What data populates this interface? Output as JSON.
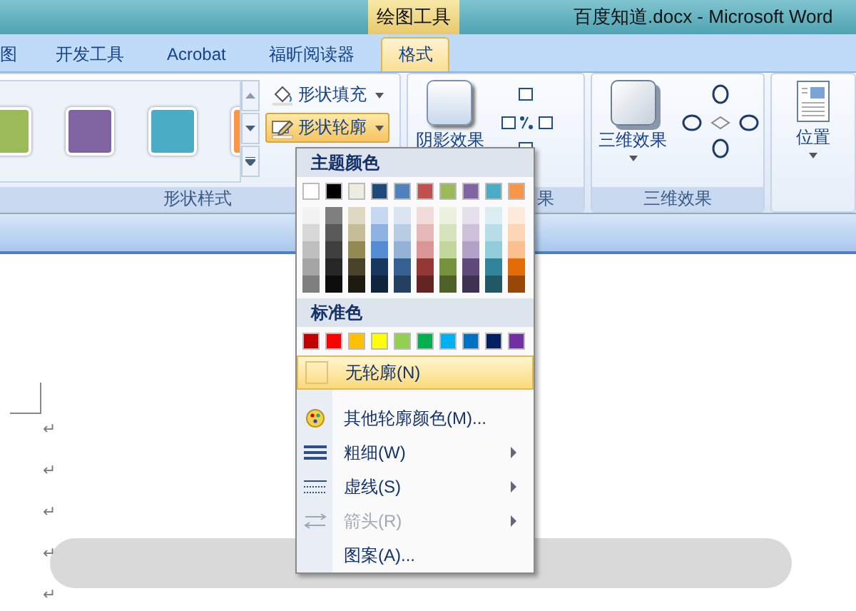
{
  "window": {
    "context_tab": "绘图工具",
    "title": "百度知道.docx - Microsoft Word"
  },
  "tabs": [
    {
      "label": "图",
      "selected": false
    },
    {
      "label": "开发工具",
      "selected": false
    },
    {
      "label": "Acrobat",
      "selected": false
    },
    {
      "label": "福昕阅读器",
      "selected": false
    },
    {
      "label": "格式",
      "selected": true
    }
  ],
  "ribbon": {
    "shape_styles": {
      "swatches": [
        {
          "color": "#9bbb59"
        },
        {
          "color": "#8064a2"
        },
        {
          "color": "#4bacc6"
        },
        {
          "color": "#f79646"
        }
      ],
      "fill_button": {
        "label": "形状填充",
        "pressed": false
      },
      "outline_button": {
        "label": "形状轮廓",
        "pressed": true
      },
      "group_label": "形状样式"
    },
    "shadow": {
      "button_label": "阴影效果",
      "group_label": "果"
    },
    "three_d": {
      "button_label": "三维效果",
      "group_label": "三维效果"
    },
    "arrange": {
      "button_label": "位置"
    }
  },
  "outline_menu": {
    "theme_heading": "主题颜色",
    "theme_colors": [
      {
        "color": "#ffffff",
        "shades": [
          {
            "color": "#f2f2f2"
          },
          {
            "color": "#d8d8d8"
          },
          {
            "color": "#bfbfbf"
          },
          {
            "color": "#a5a5a5"
          },
          {
            "color": "#7f7f7f"
          }
        ]
      },
      {
        "color": "#000000",
        "shades": [
          {
            "color": "#7f7f7f"
          },
          {
            "color": "#595959"
          },
          {
            "color": "#3f3f3f"
          },
          {
            "color": "#262626"
          },
          {
            "color": "#0c0c0c"
          }
        ]
      },
      {
        "color": "#eeece1",
        "shades": [
          {
            "color": "#ddd9c3"
          },
          {
            "color": "#c4bd97"
          },
          {
            "color": "#938953"
          },
          {
            "color": "#494429"
          },
          {
            "color": "#1d1b10"
          }
        ]
      },
      {
        "color": "#1f497d",
        "shades": [
          {
            "color": "#c6d9f0"
          },
          {
            "color": "#8db3e2"
          },
          {
            "color": "#548dd4"
          },
          {
            "color": "#17365d"
          },
          {
            "color": "#0f243e"
          }
        ]
      },
      {
        "color": "#4f81bd",
        "shades": [
          {
            "color": "#dbe5f1"
          },
          {
            "color": "#b8cce4"
          },
          {
            "color": "#95b3d7"
          },
          {
            "color": "#366092"
          },
          {
            "color": "#244061"
          }
        ]
      },
      {
        "color": "#c0504d",
        "shades": [
          {
            "color": "#f2dcdb"
          },
          {
            "color": "#e5b9b7"
          },
          {
            "color": "#d99694"
          },
          {
            "color": "#953734"
          },
          {
            "color": "#632423"
          }
        ]
      },
      {
        "color": "#9bbb59",
        "shades": [
          {
            "color": "#ebf1dd"
          },
          {
            "color": "#d7e3bc"
          },
          {
            "color": "#c3d69b"
          },
          {
            "color": "#76923c"
          },
          {
            "color": "#4f6128"
          }
        ]
      },
      {
        "color": "#8064a2",
        "shades": [
          {
            "color": "#e5e0ec"
          },
          {
            "color": "#ccc1d9"
          },
          {
            "color": "#b2a2c7"
          },
          {
            "color": "#5f497a"
          },
          {
            "color": "#3f3151"
          }
        ]
      },
      {
        "color": "#4bacc6",
        "shades": [
          {
            "color": "#dbeef3"
          },
          {
            "color": "#b7dde8"
          },
          {
            "color": "#92cddc"
          },
          {
            "color": "#31859b"
          },
          {
            "color": "#205867"
          }
        ]
      },
      {
        "color": "#f79646",
        "shades": [
          {
            "color": "#fdeada"
          },
          {
            "color": "#fbd5b5"
          },
          {
            "color": "#fac08f"
          },
          {
            "color": "#e36c09"
          },
          {
            "color": "#974806"
          }
        ]
      }
    ],
    "standard_heading": "标准色",
    "standard_colors": [
      {
        "color": "#c00000"
      },
      {
        "color": "#ff0000"
      },
      {
        "color": "#ffc000"
      },
      {
        "color": "#ffff00"
      },
      {
        "color": "#92d050"
      },
      {
        "color": "#00b050"
      },
      {
        "color": "#00b0f0"
      },
      {
        "color": "#0070c0"
      },
      {
        "color": "#002060"
      },
      {
        "color": "#7030a0"
      }
    ],
    "items": [
      {
        "kind": "no-outline",
        "label": "无轮廓(N)",
        "selected": true,
        "disabled": false,
        "submenu": false
      },
      {
        "kind": "more-colors",
        "label": "其他轮廓颜色(M)...",
        "selected": false,
        "disabled": false,
        "submenu": false
      },
      {
        "kind": "weight",
        "label": "粗细(W)",
        "selected": false,
        "disabled": false,
        "submenu": true
      },
      {
        "kind": "dashes",
        "label": "虚线(S)",
        "selected": false,
        "disabled": false,
        "submenu": true
      },
      {
        "kind": "arrows",
        "label": "箭头(R)",
        "selected": false,
        "disabled": true,
        "submenu": true
      },
      {
        "kind": "pattern",
        "label": "图案(A)...",
        "selected": false,
        "disabled": false,
        "submenu": false
      }
    ]
  },
  "document": {
    "paragraph_marks": [
      "↵",
      "↵",
      "↵",
      "↵",
      "↵"
    ]
  }
}
